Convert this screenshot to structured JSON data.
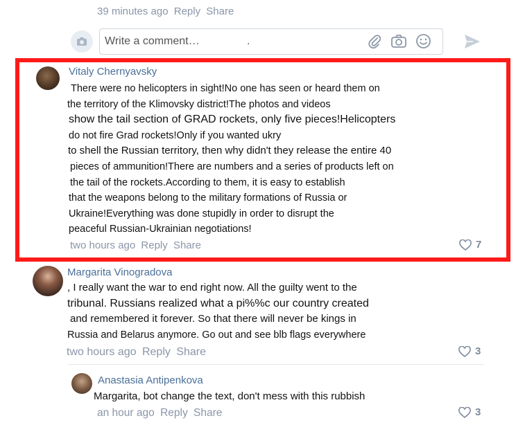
{
  "top_meta": {
    "time": "39 minutes ago",
    "reply": "Reply",
    "share": "Share"
  },
  "composer": {
    "placeholder": "Write a comment…",
    "extra": "."
  },
  "comments": [
    {
      "author": "Vitaly Chernyavsky",
      "lines": [
        "There were no helicopters in sight!No one has seen or heard them on",
        "the territory of the Klimovsky district!The photos and videos",
        "show the tail section of GRAD rockets, only five pieces!Helicopters",
        "do not fire Grad rockets!Only if you wanted ukry",
        "to shell the Russian territory, then why didn't they release the entire 40",
        "pieces of ammunition!There are numbers and a series of products left on",
        "the tail of the rockets.According to them, it is easy to establish",
        "that the weapons belong to the military formations of Russia or",
        "Ukraine!Everything was done stupidly in order to disrupt the",
        "peaceful Russian-Ukrainian negotiations!"
      ],
      "time": "two hours ago",
      "reply": "Reply",
      "share": "Share",
      "likes": "7"
    },
    {
      "author": "Margarita Vinogradova",
      "lines": [
        ", I really want the war to end right now. All the guilty went to the",
        "tribunal. Russians realized what a pi%%c our country created",
        "and remembered it forever. So that there will never be kings in",
        "Russia and Belarus anymore. Go out and see blb flags everywhere"
      ],
      "time": "two hours ago",
      "reply": "Reply",
      "share": "Share",
      "likes": "3"
    },
    {
      "author": "Anastasia Antipenkova",
      "lines": [
        "Margarita, bot change the text, don't mess with this rubbish"
      ],
      "time": "an hour ago",
      "reply": "Reply",
      "share": "Share",
      "likes": "3"
    }
  ],
  "colors": {
    "highlight": "#ff1a1a",
    "author": "#4a6f99",
    "meta": "#8a96a8"
  }
}
